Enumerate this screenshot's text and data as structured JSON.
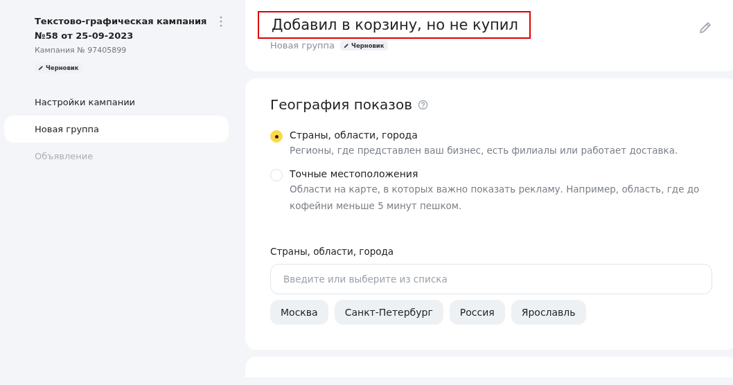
{
  "sidebar": {
    "campaign_title": "Текстово-графическая кампания №58 от 25-09-2023",
    "campaign_number": "Кампания № 97405899",
    "status_badge": "Черновик",
    "items": [
      {
        "label": "Настройки кампании",
        "selected": false,
        "disabled": false
      },
      {
        "label": "Новая группа",
        "selected": true,
        "disabled": false
      },
      {
        "label": "Объявление",
        "selected": false,
        "disabled": true
      }
    ]
  },
  "header": {
    "title": "Добавил в корзину, но не купил",
    "highlighted": true,
    "subtitle": "Новая группа",
    "status_badge": "Черновик"
  },
  "geo": {
    "title": "География показов",
    "options": [
      {
        "label": "Страны, области, города",
        "description": "Регионы, где представлен ваш бизнес, есть филиалы или работает доставка.",
        "selected": true
      },
      {
        "label": "Точные местоположения",
        "description": "Области на карте, в которых важно показать рекламу. Например, область, где до кофейни меньше 5 минут пешком.",
        "selected": false
      }
    ],
    "field_label": "Страны, области, города",
    "placeholder": "Введите или выберите из списка",
    "chips": [
      "Москва",
      "Санкт-Петербург",
      "Россия",
      "Ярославль"
    ]
  }
}
